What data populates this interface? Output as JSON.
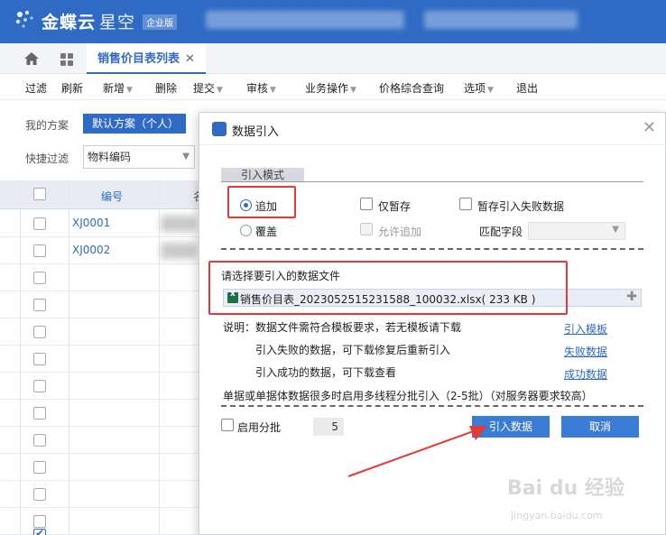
{
  "header": {
    "brand": "金蝶云",
    "brand_sub": "星空",
    "edition": "企业版"
  },
  "tabs": {
    "active_label": "销售价目表列表",
    "close_symbol": "✕"
  },
  "toolbar": {
    "items": [
      "过滤",
      "刷新",
      "新增",
      "删除",
      "提交",
      "审核",
      "业务操作",
      "价格综合查询",
      "选项",
      "退出"
    ]
  },
  "filter": {
    "scheme_label": "我的方案",
    "scheme_value": "默认方案（个人）",
    "quick_label": "快捷过滤",
    "quick_value": "物料编码"
  },
  "grid": {
    "col_code": "编号",
    "col_name": "名",
    "rows": [
      {
        "code": "XJ0001"
      },
      {
        "code": "XJ0002"
      }
    ]
  },
  "dialog": {
    "title": "数据引入",
    "close_symbol": "✕",
    "mode_section": "引入模式",
    "opt_append": "追加",
    "opt_overwrite": "覆盖",
    "opt_temp_save": "仅暂存",
    "opt_temp_fail": "暂存引入失败数据",
    "opt_allow_append": "允许追加",
    "match_field_label": "匹配字段",
    "file_label": "请选择要引入的数据文件",
    "file_name": "销售价目表_2023052515231588_100032.xlsx( 233 KB )",
    "note_1": "说明：数据文件需符合模板要求，若无模板请下载",
    "note_2": "引入失败的数据，可下载修复后重新引入",
    "note_3": "引入成功的数据，可下载查看",
    "link_template": "引入模板",
    "link_fail": "失败数据",
    "link_success": "成功数据",
    "note_batch": "单据或单据体数据很多时启用多线程分批引入（2-5批）（对服务器要求较高）",
    "enable_batch_label": "启用分批",
    "batch_value": "5",
    "btn_import": "引入数据",
    "btn_cancel": "取消"
  },
  "watermark": {
    "main": "Bai du 经验",
    "sub": "jingyan.baidu.com"
  },
  "colors": {
    "brand": "#2f6bc5",
    "highlight": "#e53935"
  }
}
